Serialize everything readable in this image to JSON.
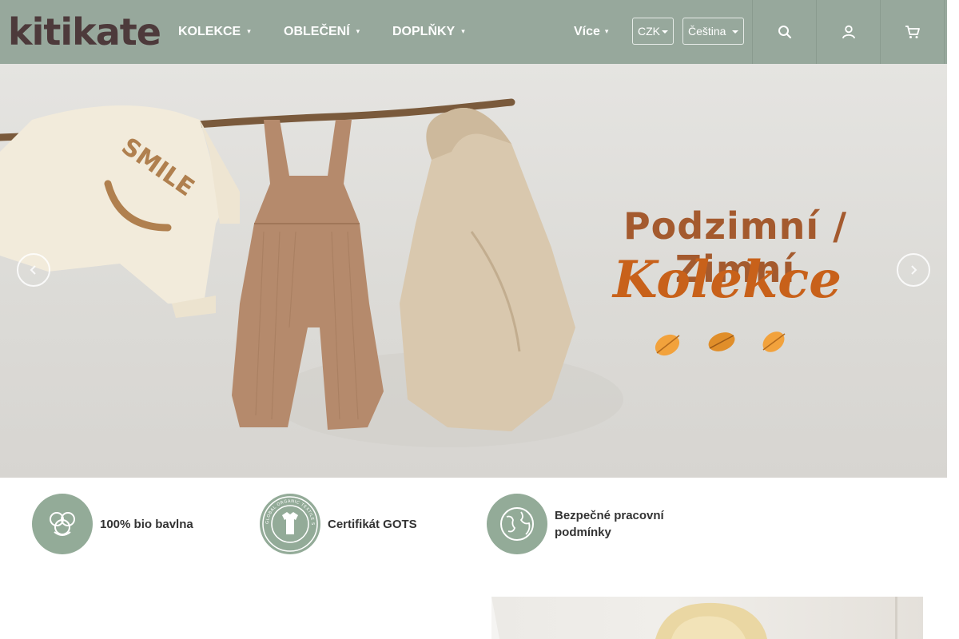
{
  "header": {
    "logo_text": "kitikate",
    "nav": [
      {
        "label": "KOLEKCE"
      },
      {
        "label": "OBLEČENÍ"
      },
      {
        "label": "DOPLŇKY"
      }
    ],
    "more_label": "Více",
    "currency": "CZK",
    "language": "Čeština",
    "icons": [
      "search-icon",
      "user-icon",
      "cart-icon"
    ],
    "background_color": "#97a89c"
  },
  "hero": {
    "title": "Podzimní / Zimní",
    "script": "Kolekce",
    "shirt_text": "SMILE",
    "prev_icon": "chevron-left-icon",
    "next_icon": "chevron-right-icon"
  },
  "features": [
    {
      "icon": "cotton-icon",
      "label": "100% bio bavlna"
    },
    {
      "icon": "gots-icon",
      "label": "Certifikát GOTS",
      "badge_text": "GLOBAL ORGANIC TEXTILE STANDARD · GOTS"
    },
    {
      "icon": "earth-icon",
      "label": "Bezpečné pracovní podmínky"
    }
  ],
  "colors": {
    "accent_green": "#93ab98",
    "title_brown": "#a45a2e",
    "script_orange": "#c8611a"
  }
}
